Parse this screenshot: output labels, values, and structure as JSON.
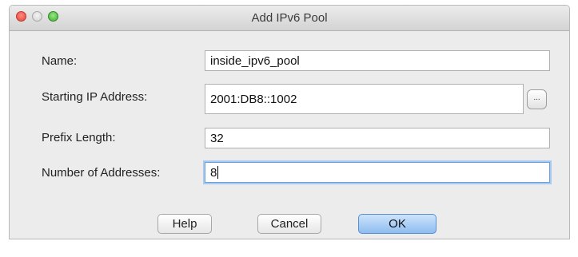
{
  "window": {
    "title": "Add IPv6 Pool"
  },
  "form": {
    "name_label": "Name:",
    "name_value": "inside_ipv6_pool",
    "start_label": "Starting IP Address:",
    "start_value": "2001:DB8::1002",
    "browse_label": "...",
    "prefix_label": "Prefix Length:",
    "prefix_value": "32",
    "count_label": "Number of Addresses:",
    "count_value": "8"
  },
  "buttons": {
    "help": "Help",
    "cancel": "Cancel",
    "ok": "OK"
  },
  "colors": {
    "close_light": "#e0443e",
    "maximize_light": "#3cb02c",
    "default_button": "#8ebdf0",
    "focus_ring": "#a9c9ef"
  }
}
